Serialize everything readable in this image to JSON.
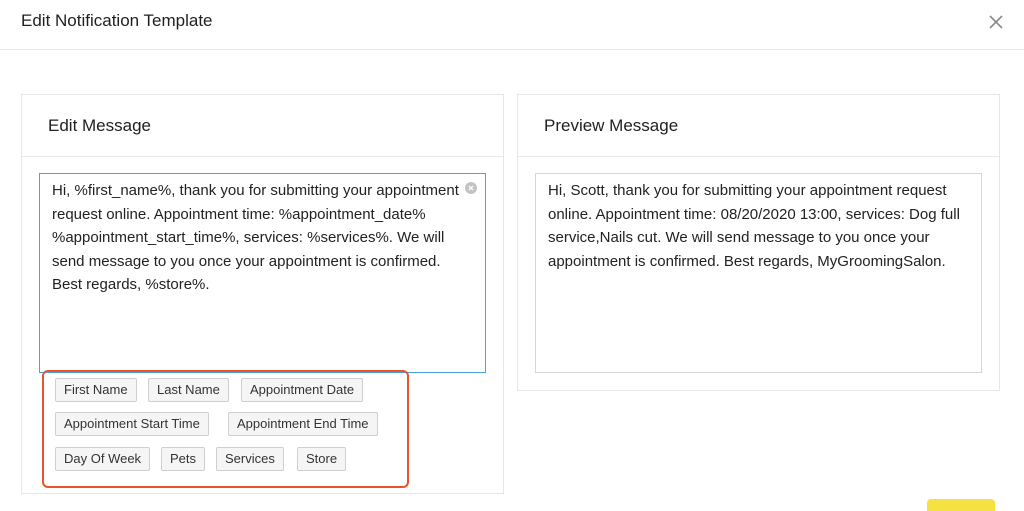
{
  "modal": {
    "title": "Edit Notification Template"
  },
  "edit_panel": {
    "title": "Edit Message",
    "message": "Hi, %first_name%, thank you for submitting your appointment request online. Appointment time: %appointment_date% %appointment_start_time%, services: %services%.  We will send message to you once your appointment is confirmed. Best regards, %store%."
  },
  "preview_panel": {
    "title": "Preview Message",
    "message": "Hi, Scott, thank you for submitting your appointment request online. Appointment time: 08/20/2020 13:00, services: Dog full service,Nails cut.  We will send message to you once your appointment is confirmed. Best regards, MyGroomingSalon."
  },
  "placeholder_tags": [
    "First Name",
    "Last Name",
    "Appointment Date",
    "Appointment Start Time",
    "Appointment End Time",
    "Day Of Week",
    "Pets",
    "Services",
    "Store"
  ],
  "icons": {
    "close": "close-icon",
    "clear": "clear-circle-icon"
  },
  "colors": {
    "highlight_border": "#e8542b",
    "input_focus_border": "#4aa3df",
    "action_button": "#f5e142"
  }
}
